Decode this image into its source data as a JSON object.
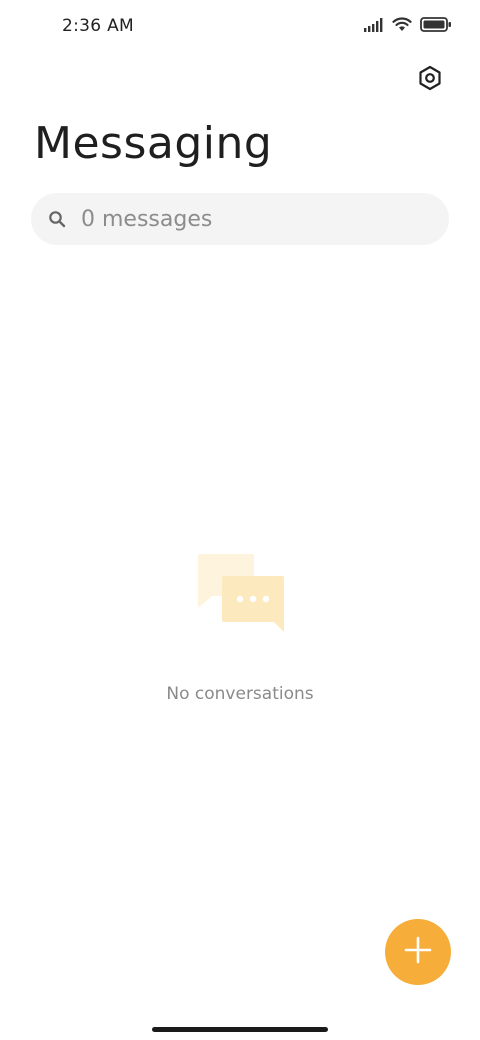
{
  "status_bar": {
    "time": "2:36 AM",
    "signal_icon": "signal-bars-icon",
    "wifi_icon": "wifi-icon",
    "battery_icon": "battery-icon"
  },
  "header": {
    "settings_icon": "settings-hexagon-icon",
    "title": "Messaging"
  },
  "search": {
    "icon": "search-icon",
    "placeholder": "0 messages"
  },
  "empty_state": {
    "icon": "chat-bubbles-icon",
    "text": "No conversations"
  },
  "fab": {
    "icon": "plus-icon"
  },
  "colors": {
    "accent": "#f6ad3a",
    "empty_icon_back": "#fef3dc",
    "empty_icon_front": "#fde9be",
    "search_bg": "#f4f4f4",
    "title": "#1f1f1f",
    "muted_text": "#8a8a8a"
  }
}
